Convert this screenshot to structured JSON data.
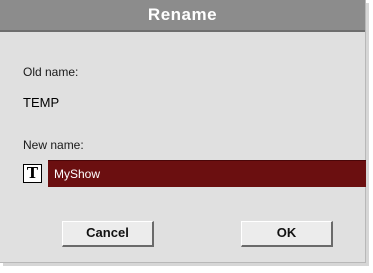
{
  "dialog": {
    "title": "Rename",
    "old_name_label": "Old name:",
    "old_name_value": "TEMP",
    "new_name_label": "New name:",
    "text_edit_icon_glyph": "T",
    "new_name_value": "MyShow"
  },
  "buttons": {
    "cancel_label": "Cancel",
    "ok_label": "OK"
  },
  "colors": {
    "titlebar": "#8c8c8c",
    "dialog_background": "#e0e0e0",
    "field_background": "#6b0f10"
  }
}
